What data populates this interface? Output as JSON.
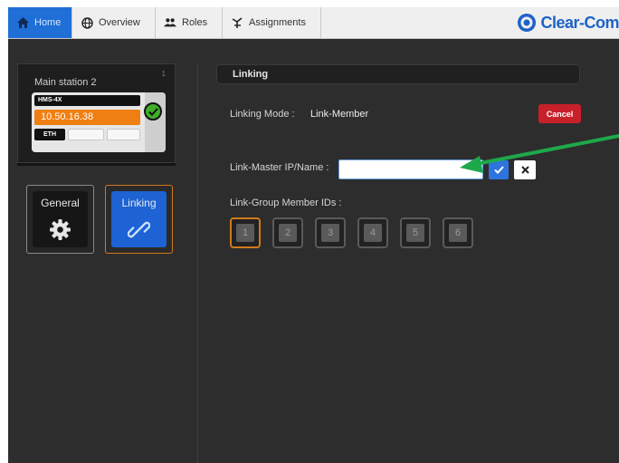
{
  "nav": {
    "tabs": [
      {
        "label": "Home",
        "icon": "home-icon",
        "active": true
      },
      {
        "label": "Overview",
        "icon": "globe-icon",
        "active": false
      },
      {
        "label": "Roles",
        "icon": "users-icon",
        "active": false
      },
      {
        "label": "Assignments",
        "icon": "assignments-icon",
        "active": false
      }
    ],
    "logo": "Clear-Com"
  },
  "station": {
    "name": "Main station 2",
    "index": "1",
    "model": "HMS-4X",
    "ip": "10.50.16.38",
    "port_label": "ETH",
    "status": "ok"
  },
  "modules": {
    "general_label": "General",
    "linking_label": "Linking"
  },
  "panel": {
    "title": "Linking",
    "mode_label": "Linking Mode :",
    "mode_value": "Link-Member",
    "cancel_label": "Cancel",
    "master_label": "Link-Master IP/Name :",
    "master_value": "",
    "group_label": "Link-Group Member IDs :",
    "member_ids": [
      "1",
      "2",
      "3",
      "4",
      "5",
      "6"
    ],
    "selected_id": "1"
  },
  "colors": {
    "accent_blue": "#1f6fd6",
    "brand_orange": "#f07f12",
    "cancel_red": "#c8202a",
    "selection_orange": "#d07a1c",
    "arrow_green": "#1fa84a"
  }
}
